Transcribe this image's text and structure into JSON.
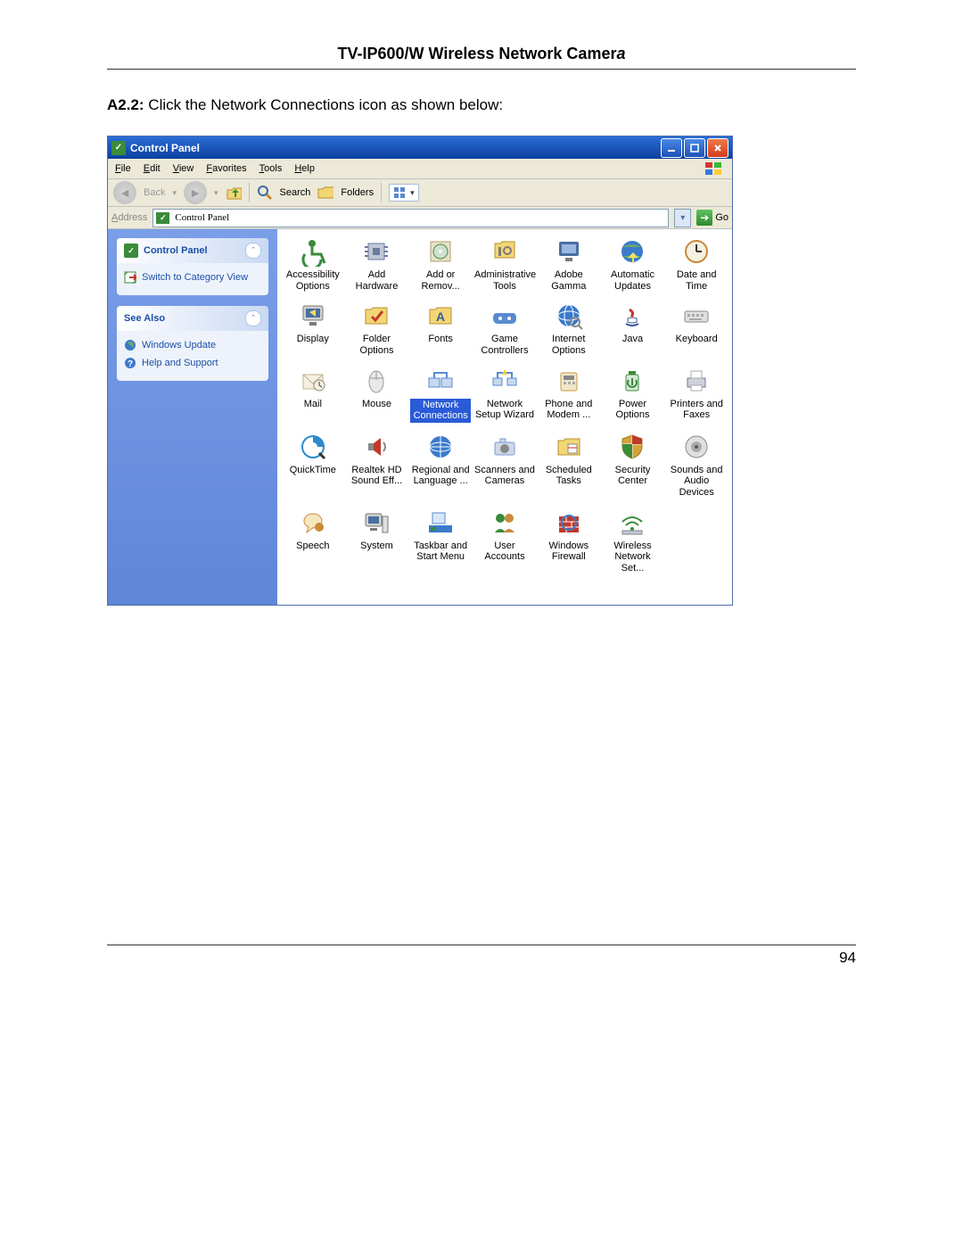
{
  "doc": {
    "title_main": "TV-IP600/W Wireless Network Camer",
    "title_ital": "a",
    "step_label": "A2.2:",
    "step_text": " Click the Network Connections icon as shown below:",
    "page_number": "94"
  },
  "win": {
    "title": "Control Panel",
    "minimize": "_",
    "maximize": "□",
    "close": "×"
  },
  "menu": {
    "file": "File",
    "edit": "Edit",
    "view": "View",
    "favorites": "Favorites",
    "tools": "Tools",
    "help": "Help"
  },
  "toolbar": {
    "back": "Back",
    "search": "Search",
    "folders": "Folders"
  },
  "address": {
    "label": "Address",
    "value": "Control Panel",
    "go": "Go"
  },
  "side": {
    "panel1_title": "Control Panel",
    "switch_view": "Switch to Category View",
    "panel2_title": "See Also",
    "windows_update": "Windows Update",
    "help_support": "Help and Support"
  },
  "icons": [
    {
      "id": "accessibility",
      "label": "Accessibility Options",
      "svg": "wheelchair",
      "c": "#3a8b3a"
    },
    {
      "id": "add-hardware",
      "label": "Add Hardware",
      "svg": "chip",
      "c": "#6a7aa0"
    },
    {
      "id": "add-remove",
      "label": "Add or Remov...",
      "svg": "cd",
      "c": "#4c8e3a"
    },
    {
      "id": "admin-tools",
      "label": "Administrative Tools",
      "svg": "tools",
      "c": "#d6a23a"
    },
    {
      "id": "adobe-gamma",
      "label": "Adobe Gamma",
      "svg": "monitor",
      "c": "#4a6fa0"
    },
    {
      "id": "auto-updates",
      "label": "Automatic Updates",
      "svg": "globe",
      "c": "#3a7a3a"
    },
    {
      "id": "date-time",
      "label": "Date and Time",
      "svg": "clock",
      "c": "#c98a3a"
    },
    {
      "id": "display",
      "label": "Display",
      "svg": "monitor2",
      "c": "#4a6fa0"
    },
    {
      "id": "folder-options",
      "label": "Folder Options",
      "svg": "foldercheck",
      "c": "#d6a23a"
    },
    {
      "id": "fonts",
      "label": "Fonts",
      "svg": "folderA",
      "c": "#d6a23a"
    },
    {
      "id": "game-ctrl",
      "label": "Game Controllers",
      "svg": "gamepad",
      "c": "#5a8ad0"
    },
    {
      "id": "inet-opts",
      "label": "Internet Options",
      "svg": "globe2",
      "c": "#3a7acc"
    },
    {
      "id": "java",
      "label": "Java",
      "svg": "java",
      "c": "#c0392b"
    },
    {
      "id": "keyboard",
      "label": "Keyboard",
      "svg": "keyboard",
      "c": "#8a8a8a"
    },
    {
      "id": "mail",
      "label": "Mail",
      "svg": "mail",
      "c": "#c4b28a"
    },
    {
      "id": "mouse",
      "label": "Mouse",
      "svg": "mouse",
      "c": "#9a9a9a"
    },
    {
      "id": "network-conn",
      "label": "Network Connections",
      "svg": "netconn",
      "c": "#5a8ad0",
      "selected": true
    },
    {
      "id": "network-setup",
      "label": "Network Setup Wizard",
      "svg": "netwiz",
      "c": "#5a8ad0"
    },
    {
      "id": "phone-modem",
      "label": "Phone and Modem ...",
      "svg": "phone",
      "c": "#c49a3a"
    },
    {
      "id": "power",
      "label": "Power Options",
      "svg": "power",
      "c": "#3a8b3a"
    },
    {
      "id": "printers",
      "label": "Printers and Faxes",
      "svg": "printer",
      "c": "#6a7aa0"
    },
    {
      "id": "quicktime",
      "label": "QuickTime",
      "svg": "qt",
      "c": "#2a8acc"
    },
    {
      "id": "realtek",
      "label": "Realtek HD Sound Eff...",
      "svg": "speaker",
      "c": "#c0392b"
    },
    {
      "id": "regional",
      "label": "Regional and Language ...",
      "svg": "globe3",
      "c": "#3a7acc"
    },
    {
      "id": "scanners",
      "label": "Scanners and Cameras",
      "svg": "camera",
      "c": "#7a9ad0"
    },
    {
      "id": "sched-tasks",
      "label": "Scheduled Tasks",
      "svg": "foldercal",
      "c": "#d6a23a"
    },
    {
      "id": "sec-center",
      "label": "Security Center",
      "svg": "shield",
      "c": "#d6a23a"
    },
    {
      "id": "sounds",
      "label": "Sounds and Audio Devices",
      "svg": "volume",
      "c": "#8a8a8a"
    },
    {
      "id": "speech",
      "label": "Speech",
      "svg": "speech",
      "c": "#c98a3a"
    },
    {
      "id": "system",
      "label": "System",
      "svg": "system",
      "c": "#4a6fa0"
    },
    {
      "id": "taskbar",
      "label": "Taskbar and Start Menu",
      "svg": "taskbar",
      "c": "#3a8b3a"
    },
    {
      "id": "users",
      "label": "User Accounts",
      "svg": "users",
      "c": "#3a8b3a"
    },
    {
      "id": "firewall",
      "label": "Windows Firewall",
      "svg": "wall",
      "c": "#c0392b"
    },
    {
      "id": "wireless",
      "label": "Wireless Network Set...",
      "svg": "wifi",
      "c": "#3a8b3a"
    }
  ]
}
